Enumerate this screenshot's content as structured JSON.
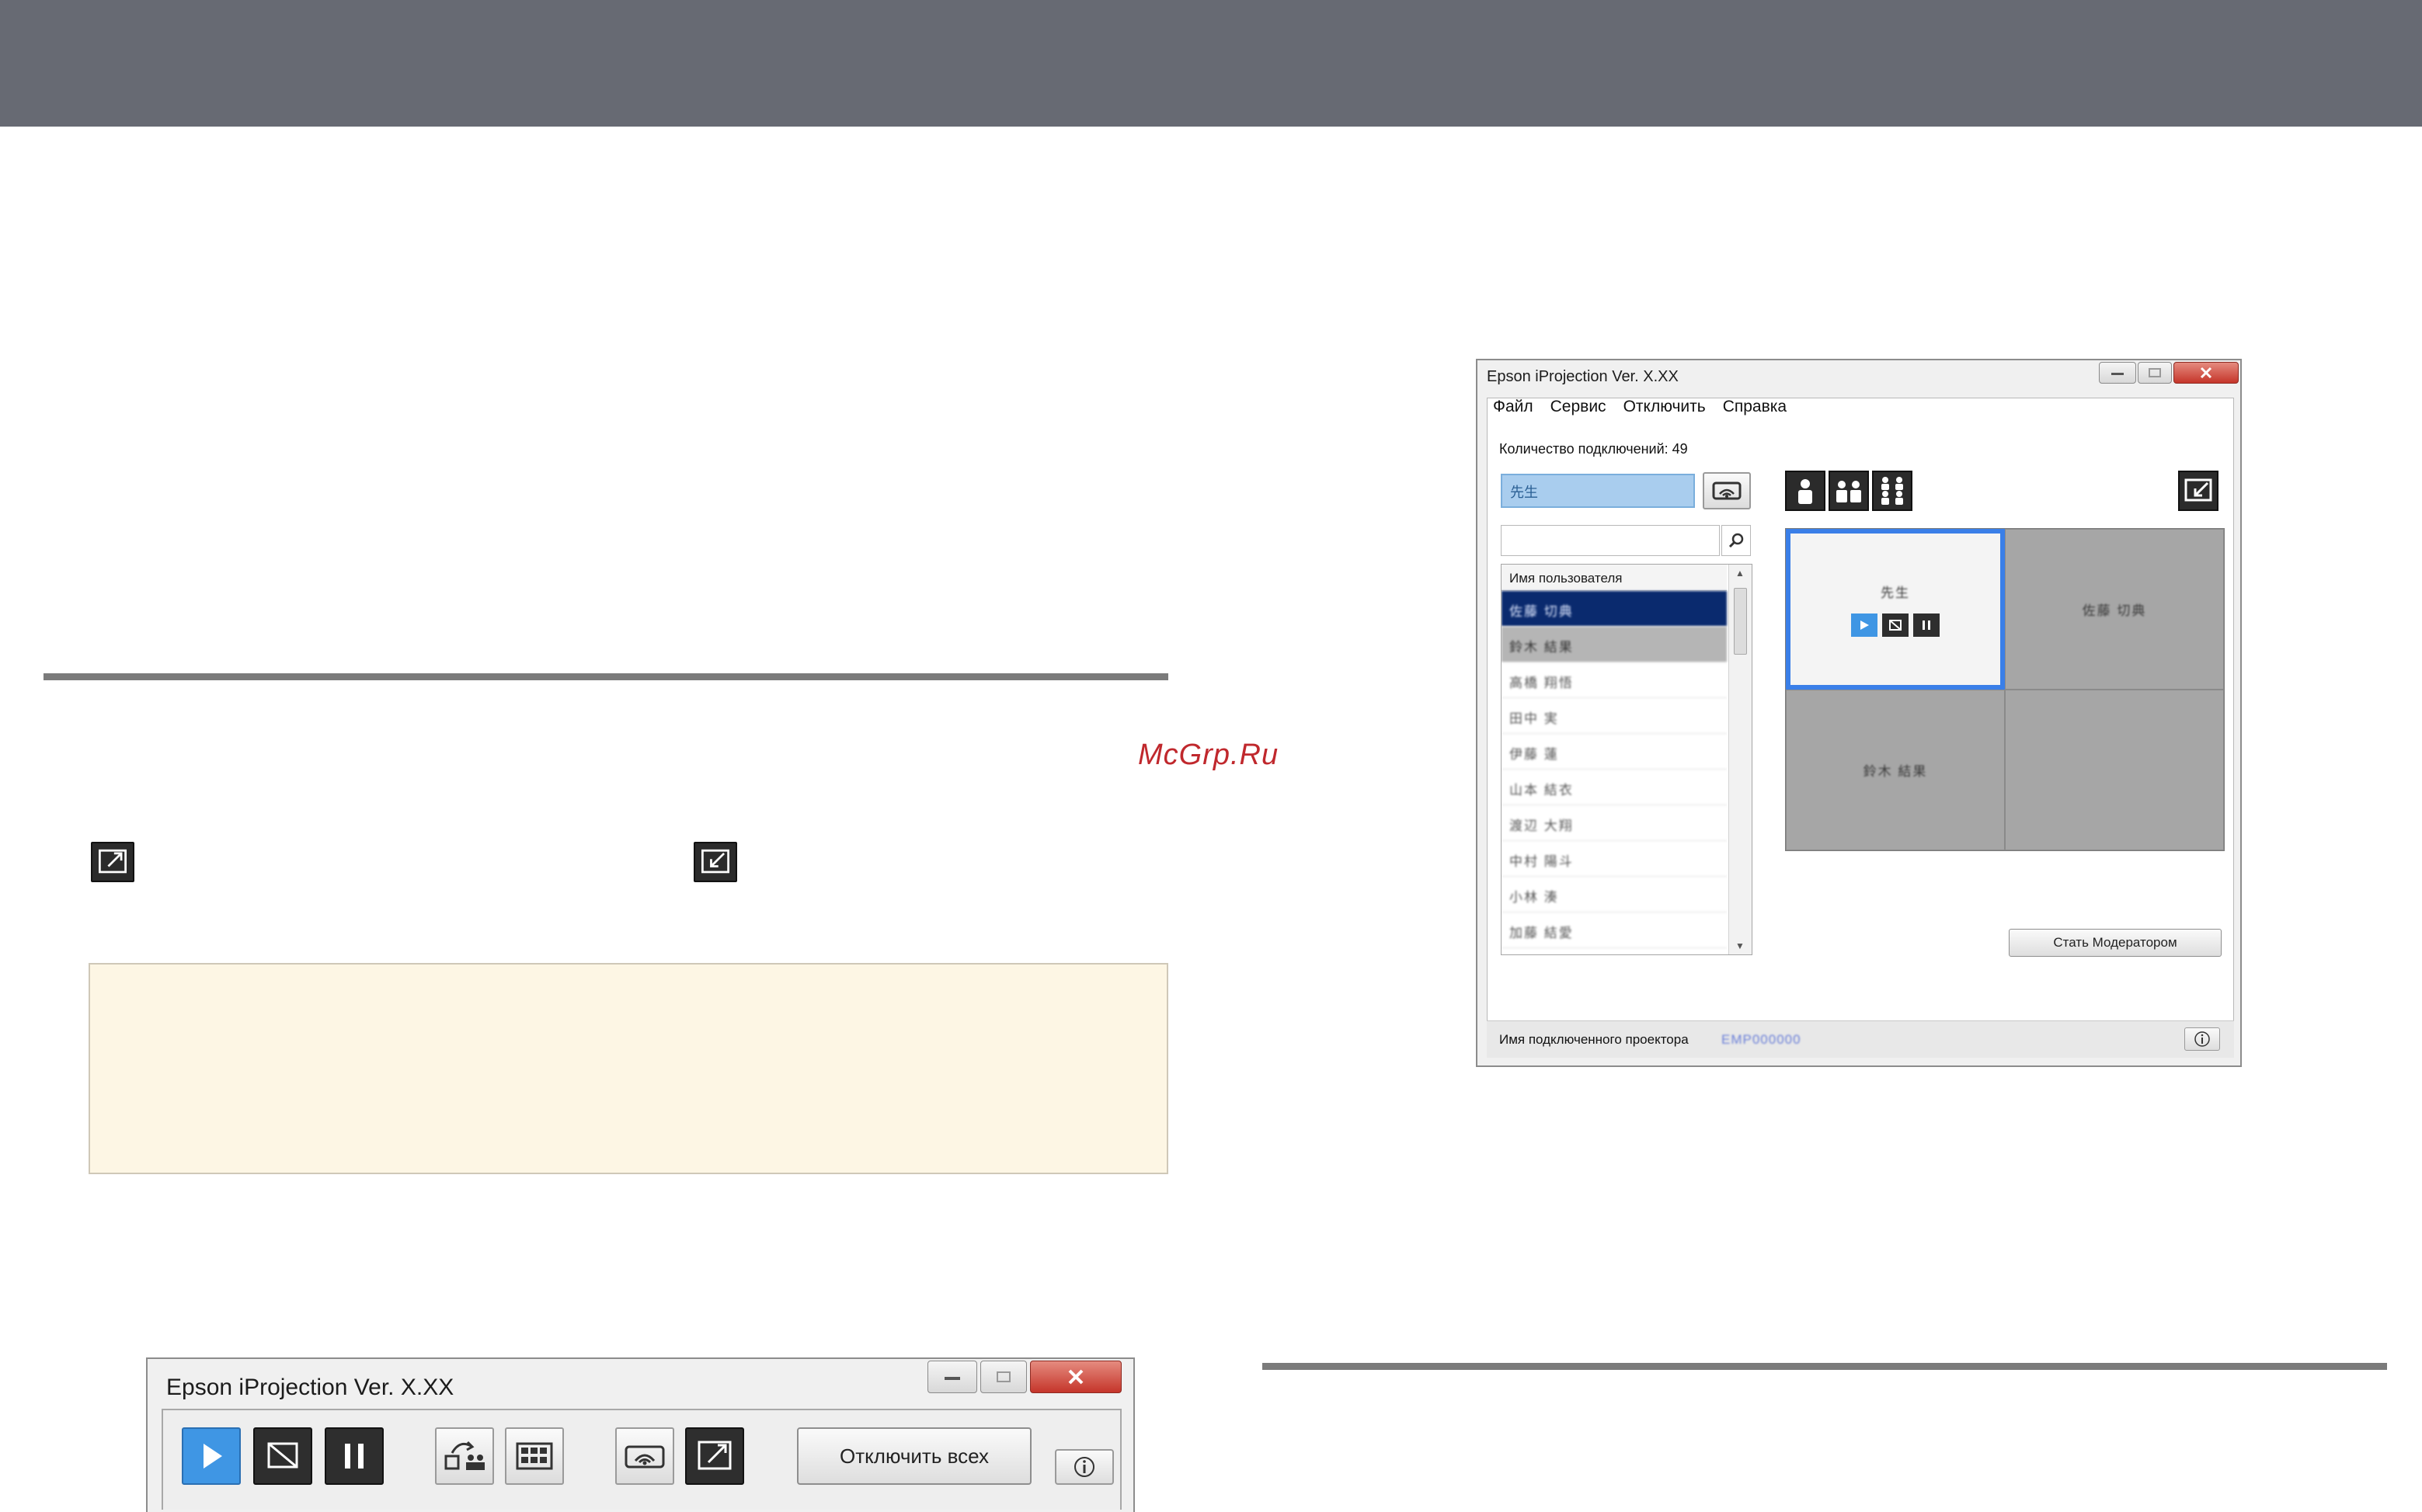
{
  "watermark": "McGrp.Ru",
  "inline_icons": [
    "expand-screen-icon",
    "shrink-screen-icon"
  ],
  "small_window": {
    "title": "Epson iProjection Ver. X.XX",
    "buttons": [
      "play-icon",
      "stop-icon",
      "pause-icon",
      "switch-presenter-icon",
      "multi-screen-icon",
      "projection-settings-icon",
      "expand-icon"
    ],
    "disconnect_all_label": "Отключить всех",
    "info_label": "i"
  },
  "large_window": {
    "title": "Epson iProjection Ver. X.XX",
    "menu": [
      "Файл",
      "Сервис",
      "Отключить",
      "Справка"
    ],
    "connection_count": "Количество подключений: 49",
    "selected_user": "先生",
    "search_placeholder": "",
    "list_header": "Имя пользователя",
    "users": [
      "佐藤 切典",
      "鈴木 結果",
      "高橋 翔悟",
      "田中 実",
      "伊藤 蓮",
      "山本 結衣",
      "渡辺 大翔",
      "中村 陽斗",
      "小林 湊",
      "加藤 結愛"
    ],
    "grid_cells": [
      "先生",
      "佐藤 切典",
      "鈴木 結果",
      ""
    ],
    "moderator_button": "Стать Модератором",
    "status_label": "Имя подключенного проектора",
    "status_value": "EMP000000",
    "info_label": "i"
  },
  "colors": {
    "topbar": "#676a73",
    "note_bg": "#fdf6e4",
    "accent_blue": "#3f96e4",
    "selection_dark": "#0a2a6e",
    "watermark": "#c0282d"
  }
}
